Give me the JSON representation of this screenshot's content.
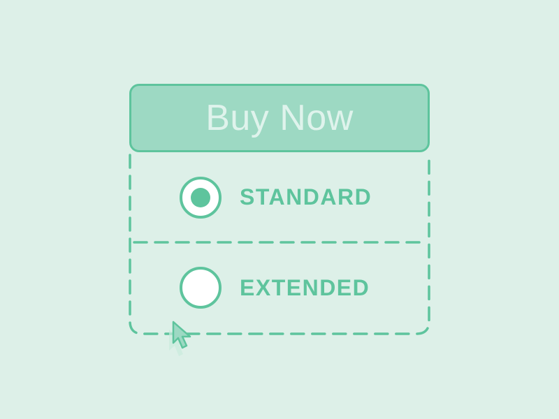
{
  "buy_button": {
    "label": "Buy Now"
  },
  "options": [
    {
      "label": "STANDARD",
      "selected": true
    },
    {
      "label": "EXTENDED",
      "selected": false
    }
  ],
  "colors": {
    "background": "#ddf0e8",
    "accent": "#5ec49d",
    "button_fill": "#9dd9c3",
    "button_text": "#dff3ec",
    "radio_fill": "#ffffff"
  },
  "icons": {
    "cursor": "mouse-pointer-icon"
  }
}
